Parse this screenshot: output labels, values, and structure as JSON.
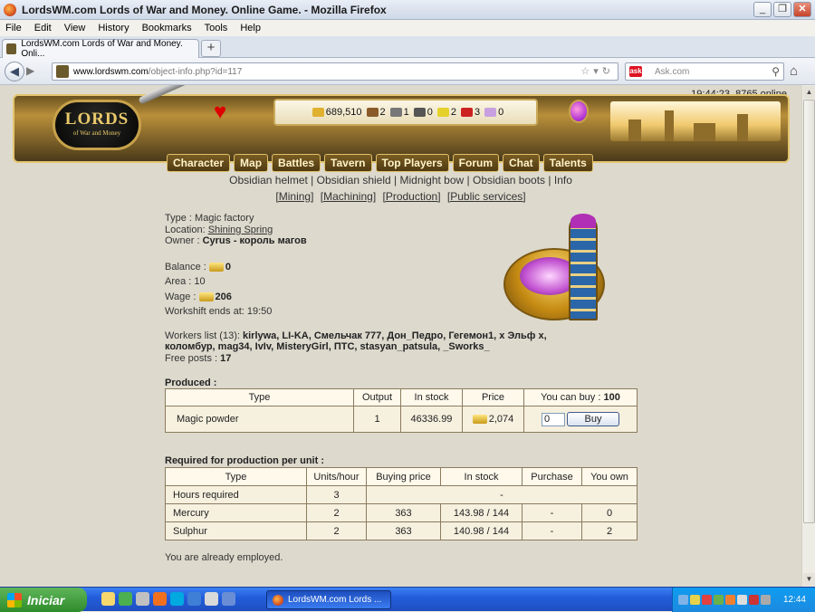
{
  "window": {
    "title": "LordsWM.com Lords of War and Money. Online Game. - Mozilla Firefox"
  },
  "menu": [
    "File",
    "Edit",
    "View",
    "History",
    "Bookmarks",
    "Tools",
    "Help"
  ],
  "tab": {
    "label": "LordsWM.com Lords of War and Money. Onli...",
    "new_tab": "+"
  },
  "address": {
    "domain": "www.lordswm.com",
    "path": "/object-info.php?id=117"
  },
  "search": {
    "placeholder": "Ask.com",
    "engine": "ask"
  },
  "status": {
    "online": "19:44:23, 8765 online"
  },
  "logo": {
    "line1": "LORDS",
    "line2": "of War and Money"
  },
  "resources": [
    {
      "icon": "gold-icon",
      "value": "689,510",
      "color": "#e0b030"
    },
    {
      "icon": "wood-icon",
      "value": "2",
      "color": "#8a5a2a"
    },
    {
      "icon": "ore-icon",
      "value": "1",
      "color": "#777777"
    },
    {
      "icon": "mercury-icon",
      "value": "0",
      "color": "#555555"
    },
    {
      "icon": "sulphur-icon",
      "value": "2",
      "color": "#e6d12a"
    },
    {
      "icon": "crystal-icon",
      "value": "3",
      "color": "#cc2222"
    },
    {
      "icon": "gems-icon",
      "value": "0",
      "color": "#c8a0e0"
    }
  ],
  "nav": [
    "Character",
    "Map",
    "Battles",
    "Tavern",
    "Top Players",
    "Forum",
    "Chat",
    "Talents"
  ],
  "crafting_links": [
    "Obsidian helmet",
    "Obsidian shield",
    "Midnight bow",
    "Obsidian boots",
    "Info"
  ],
  "category_links": [
    "[Mining]",
    "[Machining]",
    "[Production]",
    "[Public services]"
  ],
  "facility": {
    "type_label": "Type : ",
    "type": "Magic factory",
    "location_label": "Location: ",
    "location": "Shining Spring",
    "owner_label": "Owner : ",
    "owner": "Cyrus - король магов",
    "balance_label": "Balance : ",
    "balance": "0",
    "area_label": "Area : ",
    "area": "10",
    "wage_label": "Wage : ",
    "wage": "206",
    "workshift_label": "Workshift ends at: ",
    "workshift": "19:50",
    "workers_label": "Workers list (13): ",
    "workers_line1": "kirlywa, LI-KA, Смельчак 777, Дон_Педро, Гегемон1, x Эльф x,",
    "workers_line2": "коломбур, mag34, IvIv, MisteryGirl, ПТС, stasyan_patsula, _Sworks_",
    "free_posts_label": "Free posts : ",
    "free_posts": "17"
  },
  "produced": {
    "title": "Produced :",
    "headers": [
      "Type",
      "Output",
      "In stock",
      "Price",
      "You can buy : "
    ],
    "can_buy": "100",
    "row": {
      "type": "Magic powder",
      "output": "1",
      "in_stock": "46336.99",
      "price": "2,074",
      "qty": "0",
      "buy_label": "Buy"
    }
  },
  "required": {
    "title": "Required for production per unit :",
    "headers": [
      "Type",
      "Units/hour",
      "Buying price",
      "In stock",
      "Purchase",
      "You own"
    ],
    "rows": [
      {
        "type": "Hours required",
        "units": "3",
        "span": "-"
      },
      {
        "type": "Mercury",
        "units": "2",
        "price": "363",
        "stock": "143.98 / 144",
        "purchase": "-",
        "own": "0"
      },
      {
        "type": "Sulphur",
        "units": "2",
        "price": "363",
        "stock": "140.98 / 144",
        "purchase": "-",
        "own": "2"
      }
    ]
  },
  "employed_msg": "You are already employed.",
  "taskbar": {
    "start": "Iniciar",
    "task": "LordsWM.com Lords ...",
    "clock": "12:44"
  }
}
